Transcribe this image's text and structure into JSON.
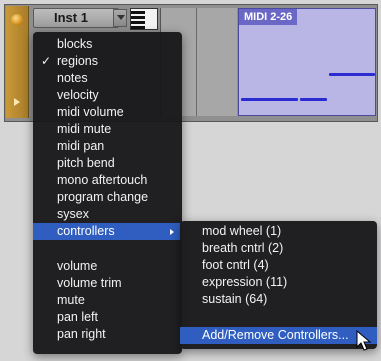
{
  "track": {
    "name": "Inst 1",
    "region_title": "MIDI 2-26"
  },
  "context_menu": {
    "group1": [
      {
        "label": "blocks",
        "checked": false
      },
      {
        "label": "regions",
        "checked": true
      },
      {
        "label": "notes",
        "checked": false
      },
      {
        "label": "velocity",
        "checked": false
      },
      {
        "label": "midi volume",
        "checked": false
      },
      {
        "label": "midi mute",
        "checked": false
      },
      {
        "label": "midi pan",
        "checked": false
      },
      {
        "label": "pitch bend",
        "checked": false
      },
      {
        "label": "mono aftertouch",
        "checked": false
      },
      {
        "label": "program change",
        "checked": false
      },
      {
        "label": "sysex",
        "checked": false
      },
      {
        "label": "controllers",
        "checked": false,
        "highlighted": true,
        "has_submenu": true
      }
    ],
    "group2": [
      {
        "label": "volume"
      },
      {
        "label": "volume trim"
      },
      {
        "label": "mute"
      },
      {
        "label": "pan left"
      },
      {
        "label": "pan right"
      }
    ],
    "check_glyph": "✓"
  },
  "controllers_submenu": {
    "items": [
      {
        "label": "mod wheel (1)"
      },
      {
        "label": "breath cntrl (2)"
      },
      {
        "label": "foot cntrl (4)"
      },
      {
        "label": "expression (11)"
      },
      {
        "label": "sustain (64)"
      }
    ],
    "action": {
      "label": "Add/Remove Controllers...",
      "highlighted": true
    }
  },
  "colors": {
    "menu_bg": "#18181a",
    "highlight": "#2f5ec0",
    "region": "#b9b6e6",
    "note": "#2a2bd1"
  }
}
